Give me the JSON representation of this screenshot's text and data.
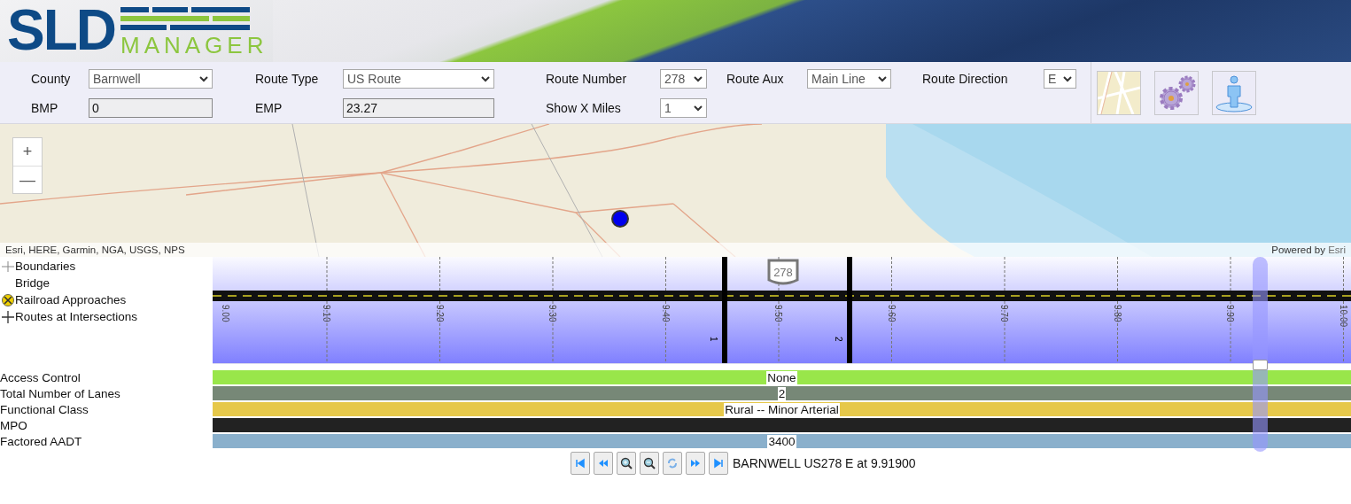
{
  "header": {
    "logo_main": "SLD",
    "logo_sub": "MANAGER"
  },
  "form": {
    "rows": [
      [
        {
          "label": "County",
          "kind": "select",
          "value": "Barnwell"
        },
        {
          "label": "Route Type",
          "kind": "select",
          "value": "US Route"
        },
        {
          "label": "Route Number",
          "kind": "select",
          "value": "278"
        },
        {
          "label": "Route Aux",
          "kind": "select",
          "value": "Main Line"
        },
        {
          "label": "Route Direction",
          "kind": "select",
          "value": "E"
        }
      ],
      [
        {
          "label": "BMP",
          "kind": "input",
          "value": "0"
        },
        {
          "label": "EMP",
          "kind": "input",
          "value": "23.27"
        },
        {
          "label": "Show X Miles",
          "kind": "select",
          "value": "1"
        }
      ]
    ],
    "tools": [
      {
        "kind": "map"
      },
      {
        "kind": "gears"
      },
      {
        "kind": "person"
      }
    ]
  },
  "map": {
    "zoom_in": "+",
    "zoom_out": "—",
    "attribution": "Esri, HERE, Garmin, NGA, USGS, NPS",
    "powered_by": "Powered by ",
    "powered_link": "Esri"
  },
  "legend": [
    {
      "kind": "boundary",
      "label": "Boundaries"
    },
    {
      "kind": "bridge",
      "label": "Bridge"
    },
    {
      "kind": "railroad",
      "label": "Railroad Approaches"
    },
    {
      "kind": "intersection",
      "label": "Routes at Intersections"
    }
  ],
  "track": {
    "ticks": [
      "9.00",
      "9.10",
      "9.20",
      "9.30",
      "9.40",
      "9.50",
      "9.60",
      "9.70",
      "9.80",
      "9.90",
      "10.00"
    ],
    "shield": "278",
    "boundaries": [
      {
        "label": "1"
      },
      {
        "label": "2"
      }
    ],
    "position_marker": {
      "level": 0.92
    }
  },
  "attributes": [
    {
      "label": "Access Control",
      "value": "None",
      "color": "#99e64a"
    },
    {
      "label": "Total Number of Lanes",
      "value": "2",
      "color": "#778877"
    },
    {
      "label": "Functional Class",
      "value": "Rural -- Minor Arterial",
      "color": "#e6c84a"
    },
    {
      "label": "MPO",
      "color": "#222222"
    },
    {
      "label": "Factored AADT",
      "value": "3400",
      "color": "#8ab0cc"
    }
  ],
  "nav": {
    "buttons": [
      {
        "kind": "first"
      },
      {
        "kind": "prev"
      },
      {
        "kind": "zoom_in"
      },
      {
        "kind": "zoom_out"
      },
      {
        "kind": "refresh"
      },
      {
        "kind": "next"
      },
      {
        "kind": "last"
      }
    ],
    "status": "BARNWELL US278 E at 9.91900"
  }
}
